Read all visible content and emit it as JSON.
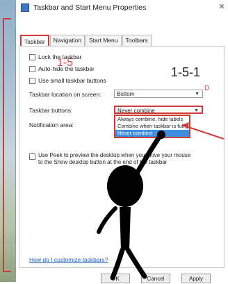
{
  "window": {
    "title": "Taskbar and Start Menu Properties",
    "close_glyph": "✕"
  },
  "tabs": [
    {
      "label": "Taskbar"
    },
    {
      "label": "Navigation"
    },
    {
      "label": "Start Menu"
    },
    {
      "label": "Toolbars"
    }
  ],
  "checkboxes": {
    "lock": "Lock the taskbar",
    "autohide": "Auto-hide the taskbar",
    "small": "Use small taskbar buttons"
  },
  "location": {
    "label": "Taskbar location on screen:",
    "value": "Bottom"
  },
  "buttons": {
    "label": "Taskbar buttons:",
    "value": "Never combine",
    "options": [
      "Always combine, hide labels",
      "Combine when taskbar is full",
      "Never combine"
    ],
    "selected_index": 2
  },
  "notification": {
    "label": "Notification area:"
  },
  "peek": {
    "label": "Use Peek to preview the desktop when you move your mouse to the Show desktop button at the end of the taskbar"
  },
  "help_link": "How do I customize taskbars?",
  "actions": {
    "ok": "OK",
    "cancel": "Cancel",
    "apply": "Apply"
  },
  "annotations": {
    "step_a": "1-5",
    "step_b": "1-5-1",
    "edge_letter": "D"
  },
  "colors": {
    "annotation_red": "#d23a3a",
    "selection_blue": "#3e8fe0",
    "link_blue": "#1c5cbf"
  }
}
